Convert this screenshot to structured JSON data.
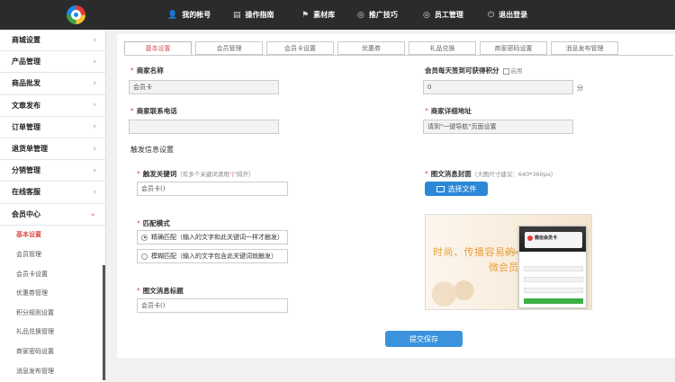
{
  "topnav": [
    {
      "icon": "user-icon",
      "glyph": "👤",
      "label": "我的帐号"
    },
    {
      "icon": "document-icon",
      "glyph": "▤",
      "label": "操作指南"
    },
    {
      "icon": "flag-icon",
      "glyph": "⚑",
      "label": "素材库"
    },
    {
      "icon": "globe-icon",
      "glyph": "◎",
      "label": "推广技巧"
    },
    {
      "icon": "globe-icon",
      "glyph": "◎",
      "label": "员工管理"
    },
    {
      "icon": "power-icon",
      "glyph": "⏻",
      "label": "退出登录"
    }
  ],
  "sidebar": {
    "items": [
      {
        "label": "商城设置"
      },
      {
        "label": "产品管理"
      },
      {
        "label": "商品批发"
      },
      {
        "label": "文章发布"
      },
      {
        "label": "订单管理"
      },
      {
        "label": "退货单管理"
      },
      {
        "label": "分销管理"
      },
      {
        "label": "在线客服"
      },
      {
        "label": "会员中心"
      }
    ],
    "subitems": [
      {
        "label": "基本设置"
      },
      {
        "label": "会员管理"
      },
      {
        "label": "会员卡设置"
      },
      {
        "label": "优惠券管理"
      },
      {
        "label": "积分规则设置"
      },
      {
        "label": "礼品兑换管理"
      },
      {
        "label": "商家密码设置"
      },
      {
        "label": "消息发布管理"
      }
    ]
  },
  "tabs": [
    "基本设置",
    "会员管理",
    "会员卡设置",
    "优惠券",
    "礼品兑换",
    "商家密码设置",
    "消息发布管理"
  ],
  "form": {
    "merchant_name_label": "商家名称",
    "merchant_name_value": "会员卡",
    "daily_points_label": "会员每天签到可获得积分",
    "enable_label": "启用",
    "daily_points_value": "0",
    "points_unit": "分",
    "phone_label": "商家联系电话",
    "address_label": "商家详细地址",
    "address_value": "请到\"一键导航\"页面设置",
    "trigger_section": "触发信息设置",
    "keyword_label": "触发关键词",
    "keyword_hint_a": "（有多个关键词请用\"",
    "keyword_hint_sep": "|",
    "keyword_hint_b": "\"隔开）",
    "keyword_value": "会员卡()",
    "match_label": "匹配模式",
    "match_exact": "精确匹配（输入的文字和此关键词一样才触发）",
    "match_fuzzy": "模糊匹配（输入的文字包含此关键词就触发）",
    "msg_title_label": "图文消息标题",
    "msg_title_value": "会员卡()",
    "cover_label": "图文消息封面",
    "cover_hint": "（大图尺寸建议：640*360px）",
    "choose_file": "选择文件",
    "submit": "提交保存"
  },
  "cover_image": {
    "headline_a": "时尚、传播容易的",
    "headline_b": "微会员卡",
    "card_brand": "MEMBER CARD",
    "phone_title": "微信会员卡"
  }
}
